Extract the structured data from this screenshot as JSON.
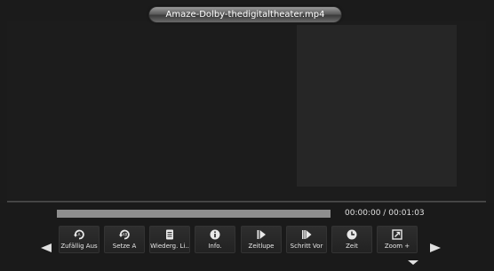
{
  "window": {
    "title": "Amaze-Dolby-thedigitaltheater.mp4"
  },
  "playback": {
    "current_time": "00:00:00",
    "separator": "/",
    "total_time": "00:01:03",
    "progress_fraction": 0.0
  },
  "controls": [
    {
      "label": "Zufällig Aus",
      "icon": "shuffle-icon"
    },
    {
      "label": "Setze A",
      "icon": "repeat-ab-icon"
    },
    {
      "label": "Wiederg. Li..",
      "icon": "playlist-icon"
    },
    {
      "label": "Info.",
      "icon": "info-icon"
    },
    {
      "label": "Zeitlupe",
      "icon": "slow-motion-icon"
    },
    {
      "label": "Schritt Vor",
      "icon": "step-forward-icon"
    },
    {
      "label": "Zeit",
      "icon": "clock-icon"
    },
    {
      "label": "Zoom +",
      "icon": "zoom-icon"
    }
  ],
  "colors": {
    "background": "#1a1a1a",
    "progress_track": "#8e8e8e",
    "text": "#e6e6e6"
  }
}
